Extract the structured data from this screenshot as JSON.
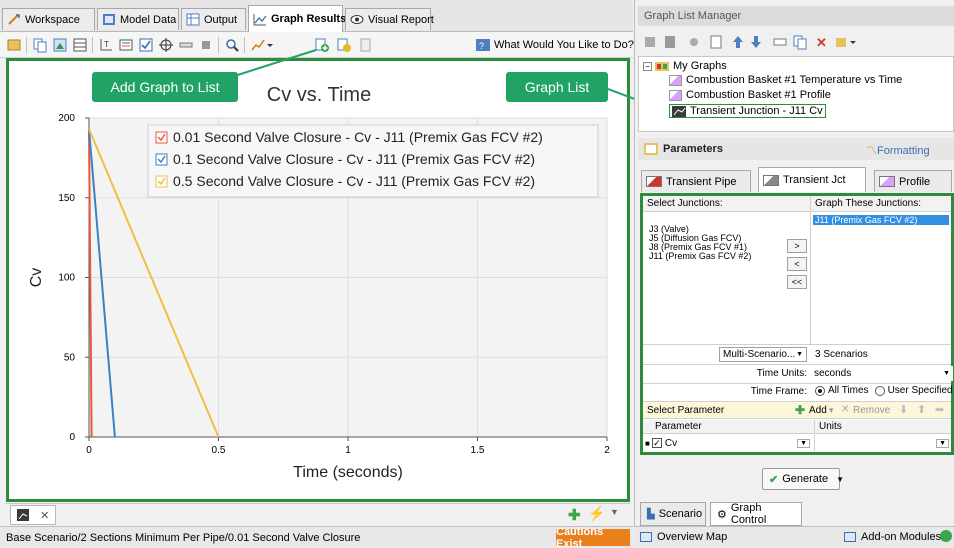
{
  "tabs": [
    {
      "label": "Workspace"
    },
    {
      "label": "Model Data"
    },
    {
      "label": "Output"
    },
    {
      "label": "Graph Results"
    },
    {
      "label": "Visual Report"
    }
  ],
  "toolbar": {
    "help_label": "What Would You Like to Do?"
  },
  "callouts": {
    "add_graph": "Add Graph to List",
    "graph_list": "Graph List"
  },
  "chart_data": {
    "type": "line",
    "title": "Cv vs. Time",
    "xlabel": "Time (seconds)",
    "ylabel": "Cv",
    "xlim": [
      0,
      2
    ],
    "ylim": [
      0,
      200
    ],
    "x_ticks": [
      "0",
      "0.5",
      "1",
      "1.5",
      "2"
    ],
    "y_ticks": [
      "0",
      "50",
      "100",
      "150",
      "200"
    ],
    "grid": true,
    "legend_position": "top-right",
    "series": [
      {
        "name": "0.01 Second Valve Closure - Cv - J11 (Premix Gas FCV #2)",
        "color": "#e8563e",
        "x": [
          0,
          0.01
        ],
        "y": [
          193,
          0
        ]
      },
      {
        "name": "0.1 Second Valve Closure - Cv - J11 (Premix Gas FCV #2)",
        "color": "#3b82c4",
        "x": [
          0,
          0.1
        ],
        "y": [
          193,
          0
        ]
      },
      {
        "name": "0.5 Second Valve Closure - Cv - J11 (Premix Gas FCV #2)",
        "color": "#f0c043",
        "x": [
          0,
          0.5
        ],
        "y": [
          193,
          0
        ]
      }
    ]
  },
  "status": {
    "scenario_path": "Base Scenario/2 Sections Minimum Per Pipe/0.01 Second Valve Closure",
    "cautions": "Cautions Exist"
  },
  "right": {
    "graph_list_title": "Graph List Manager",
    "tree_root": "My Graphs",
    "tree_items": [
      {
        "label": "Combustion Basket #1 Temperature vs Time"
      },
      {
        "label": "Combustion Basket #1 Profile"
      },
      {
        "label": "Transient Junction - J11 Cv"
      }
    ],
    "parameters_title": "Parameters",
    "formatting_label": "Formatting",
    "param_tabs": [
      {
        "label": "Transient Pipe"
      },
      {
        "label": "Transient Jct"
      },
      {
        "label": "Profile"
      }
    ],
    "select_junctions_label": "Select Junctions:",
    "graph_these_label": "Graph These Junctions:",
    "junctions": [
      {
        "label": "J3 (Valve)"
      },
      {
        "label": "J5 (Diffusion Gas FCV)"
      },
      {
        "label": "J8 (Premix Gas FCV #1)"
      },
      {
        "label": "J11 (Premix Gas FCV #2)"
      }
    ],
    "selected_junction": "J11 (Premix Gas FCV #2)",
    "move_buttons": [
      ">",
      "<",
      "<<"
    ],
    "multi_scenario_label": "Multi-Scenario...",
    "scenarios_value": "3 Scenarios",
    "time_units_label": "Time Units:",
    "time_units_value": "seconds",
    "time_frame_label": "Time Frame:",
    "all_times_label": "All Times",
    "user_specified_label": "User Specified",
    "select_parameter_label": "Select Parameter",
    "add_label": "Add",
    "remove_label": "Remove",
    "param_col": "Parameter",
    "units_col": "Units",
    "param_value": "Cv",
    "generate_label": "Generate",
    "bottom_tabs": [
      {
        "label": "Scenario"
      },
      {
        "label": "Graph Control"
      }
    ],
    "overview_map": "Overview Map",
    "addon_modules": "Add-on Modules"
  }
}
